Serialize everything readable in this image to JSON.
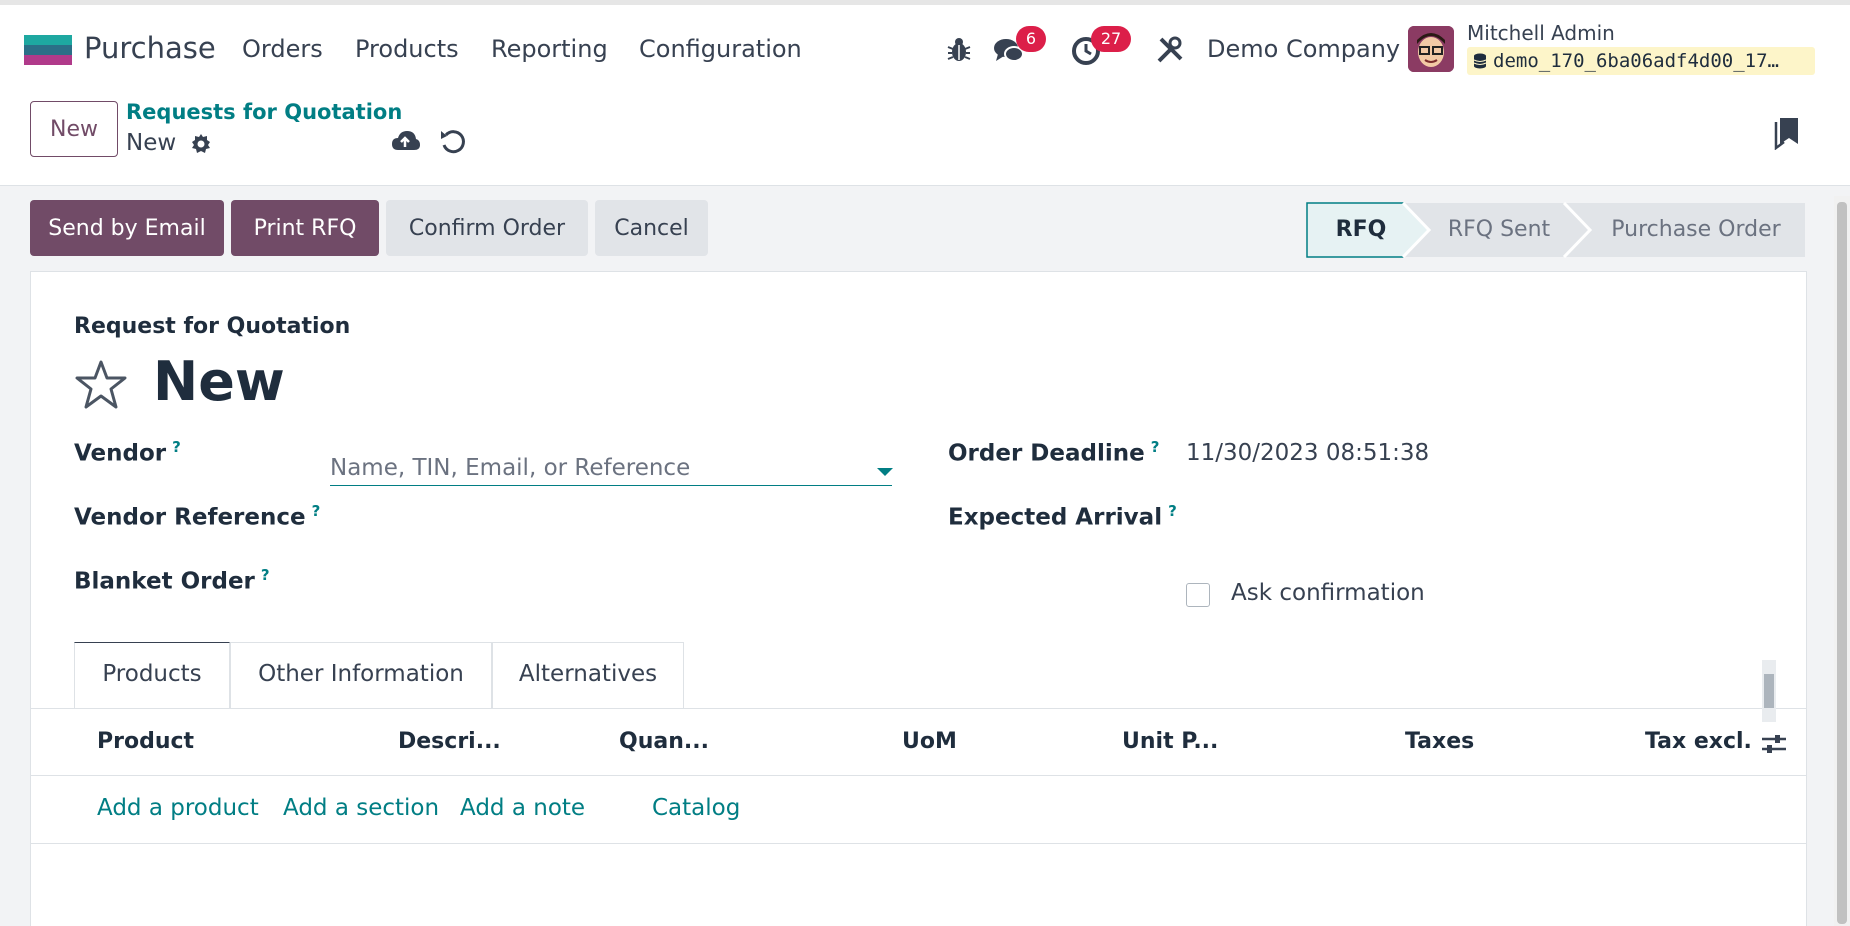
{
  "navbar": {
    "app_name": "Purchase",
    "menu": [
      "Orders",
      "Products",
      "Reporting",
      "Configuration"
    ],
    "messages_count": "6",
    "activities_count": "27",
    "company": "Demo Company",
    "user_name": "Mitchell Admin",
    "database": "demo_170_6ba06adf4d00_17…"
  },
  "control_panel": {
    "new_button": "New",
    "breadcrumb": "Requests for Quotation",
    "record_name": "New"
  },
  "actions": {
    "send_by_email": "Send by Email",
    "print_rfq": "Print RFQ",
    "confirm_order": "Confirm Order",
    "cancel": "Cancel"
  },
  "statusbar": {
    "stages": [
      "RFQ",
      "RFQ Sent",
      "Purchase Order"
    ],
    "current": "RFQ"
  },
  "form": {
    "subtitle": "Request for Quotation",
    "title": "New",
    "help_marker": "?",
    "vendor_label": "Vendor",
    "vendor_placeholder": "Name, TIN, Email, or Reference",
    "vendor_reference_label": "Vendor Reference",
    "blanket_order_label": "Blanket Order",
    "order_deadline_label": "Order Deadline",
    "order_deadline_value": "11/30/2023 08:51:38",
    "expected_arrival_label": "Expected Arrival",
    "ask_confirmation_label": "Ask confirmation",
    "ask_confirmation_checked": false
  },
  "tabs": [
    "Products",
    "Other Information",
    "Alternatives"
  ],
  "active_tab": "Products",
  "table": {
    "columns": [
      "Product",
      "Descri...",
      "Quan...",
      "UoM",
      "Unit P...",
      "Taxes",
      "Tax excl."
    ],
    "actions": [
      "Add a product",
      "Add a section",
      "Add a note",
      "Catalog"
    ]
  },
  "colors": {
    "primary": "#714b67",
    "accent": "#017e84",
    "badge": "#dc1f49"
  }
}
